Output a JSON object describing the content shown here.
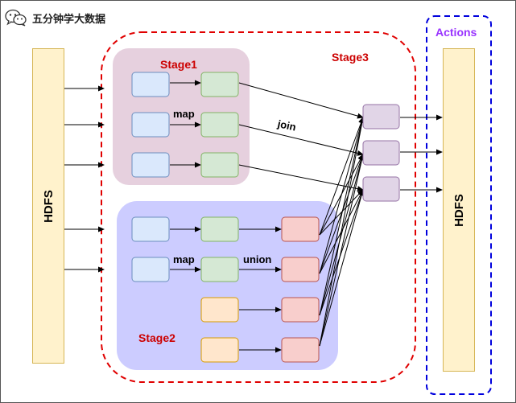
{
  "brand": {
    "text": "五分钟学大数据",
    "icon": "wechat-icon"
  },
  "storage": {
    "left_label": "HDFS",
    "right_label": "HDFS"
  },
  "stages": {
    "stage1": "Stage1",
    "stage2": "Stage2",
    "stage3": "Stage3",
    "actions": "Actions"
  },
  "operations": {
    "map_top": "map",
    "map_bottom": "map",
    "join": "join",
    "union": "union"
  },
  "colors": {
    "stage1_fill": "#e6d0de",
    "stage2_fill": "#ccccff",
    "stage3_border": "#e00000",
    "actions_border": "#0000dd",
    "source_fill": "#dae8fc",
    "source_stroke": "#6c8ebf",
    "map_fill": "#d5e8d4",
    "map_stroke": "#82b366",
    "union_fill": "#f8cecc",
    "union_stroke": "#b85450",
    "orange_fill": "#ffe6cc",
    "orange_stroke": "#d79b00",
    "join_fill": "#e1d5e7",
    "join_stroke": "#9673a6",
    "hdfs_fill": "#fff2cc",
    "hdfs_stroke": "#d6b656"
  }
}
